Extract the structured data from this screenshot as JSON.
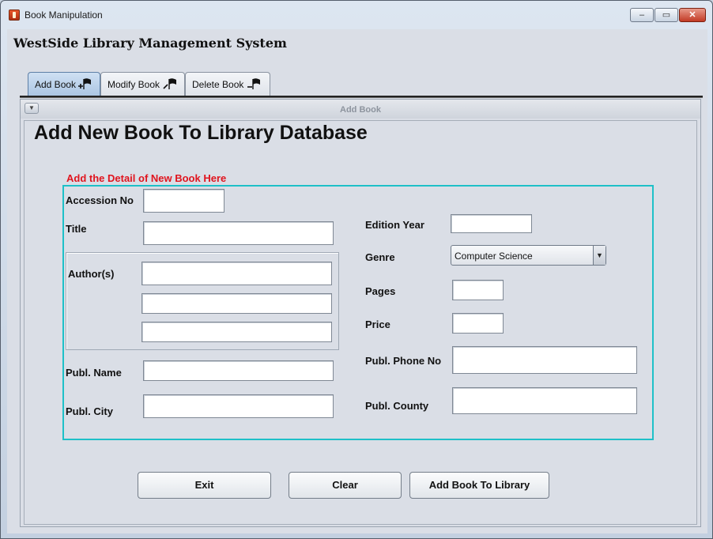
{
  "window": {
    "title": "Book Manipulation",
    "min_label": "–",
    "max_label": "▭",
    "close_label": "✕"
  },
  "app": {
    "title": "WestSide Library Management System"
  },
  "tabs": [
    {
      "label": "Add Book"
    },
    {
      "label": "Modify Book"
    },
    {
      "label": "Delete Book"
    }
  ],
  "panel": {
    "toggle": "▼",
    "title": "Add Book",
    "heading": "Add New Book To Library Database",
    "subtitle": "Add the Detail of New Book Here"
  },
  "form": {
    "accession_label": "Accession No",
    "accession_value": "",
    "title_label": "Title",
    "title_value": "",
    "authors_label": "Author(s)",
    "author1_value": "",
    "author2_value": "",
    "author3_value": "",
    "publ_name_label": "Publ. Name",
    "publ_name_value": "",
    "publ_city_label": "Publ. City",
    "publ_city_value": "",
    "edition_year_label": "Edition Year",
    "edition_year_value": "",
    "genre_label": "Genre",
    "genre_value": "Computer Science",
    "genre_arrow": "▼",
    "pages_label": "Pages",
    "pages_value": "",
    "price_label": "Price",
    "price_value": "",
    "phone_label": "Publ. Phone No",
    "phone_value": "",
    "county_label": "Publ. County",
    "county_value": ""
  },
  "buttons": {
    "exit": "Exit",
    "clear": "Clear",
    "add": "Add Book To Library"
  },
  "colors": {
    "subtitle": "#e0141e",
    "form_border": "#1ec0c8",
    "active_tab": "#a9c4e2"
  },
  "icons": {
    "app": "java-cup-icon",
    "tab": "flag-icon"
  }
}
